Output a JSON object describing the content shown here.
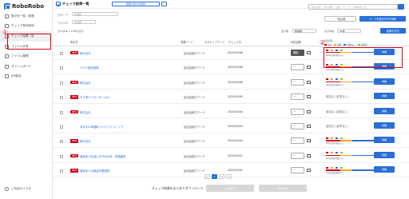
{
  "app": {
    "logo_text": "RoboRobo"
  },
  "sidebar": {
    "items": [
      {
        "label": "取引先一覧・新規",
        "icon": "users-icon"
      },
      {
        "label": "チェック条件設定",
        "icon": "settings-icon"
      },
      {
        "label": "チェック結果一覧",
        "icon": "check-icon"
      },
      {
        "label": "ファイル共有",
        "icon": "file-icon"
      },
      {
        "label": "ファイル管理",
        "icon": "folder-icon"
      },
      {
        "label": "ダッシュボード",
        "icon": "chart-icon"
      },
      {
        "label": "API設定",
        "icon": "gear-icon"
      }
    ],
    "footer_label": "ご利用ガイドを",
    "annotation_number": "①"
  },
  "header": {
    "title": "チェック結果一覧",
    "sub_button": "結果を取引先選択",
    "search_placeholder": "取引先名・法人番号・住所・キーワード検索を入力"
  },
  "filters": {
    "group_label": "グループ",
    "group_value": "未選択",
    "folder_label": "フォルダ",
    "folder_value": "未選択"
  },
  "actions": {
    "list_button": "一括反映",
    "pdf_button": "ページを表示(PDF印刷)",
    "send_button": "結果を送る"
  },
  "summary": {
    "count_text": "全31件中 1-20件を表示",
    "sort_label": "並び順",
    "sort_value": "新着順",
    "per_page_label": "表示件数",
    "per_page_value": "20件"
  },
  "table": {
    "headers": [
      "取引先",
      "重要ワード",
      "ネガティブワード",
      "チェック日",
      "判定結果",
      "ステータス"
    ],
    "rows": [
      {
        "is_new": true,
        "new_label": "NEW",
        "name": "株式会社",
        "type": "反社会勢力ワード",
        "date": "2024/03/06",
        "judgment": "確認",
        "dark": true,
        "status": "",
        "has_mini": true
      },
      {
        "is_new": false,
        "new_label": "",
        "name": "ラクシ歯科医院",
        "type": "反社会勢力ワード",
        "date": "2024/03/06",
        "judgment": "一",
        "dark": false,
        "status": "",
        "has_mini": true
      },
      {
        "is_new": true,
        "new_label": "NEW",
        "name": "株式会社",
        "type": "反社会勢力ワード",
        "date": "2024/03/06",
        "judgment": "一",
        "dark": false,
        "status": "",
        "has_mini": true
      },
      {
        "is_new": true,
        "new_label": "NEW",
        "name": "ホテ恵アイセンター(LS)",
        "type": "反社会勢力ワード",
        "date": "2024/03/05",
        "judgment": "一",
        "dark": false,
        "status": "該当なし(記事なし)",
        "has_mini": false
      },
      {
        "is_new": true,
        "new_label": "NEW",
        "name": "株式会社",
        "type": "反社会勢力ワード",
        "date": "2024/03/04",
        "judgment": "一",
        "dark": false,
        "status": "該当なし(記事なし)",
        "has_mini": false
      },
      {
        "is_new": false,
        "new_label": "",
        "name": "あなかの幸福町リハビリクリニック",
        "type": "反社会勢力ワード",
        "date": "2024/03/04",
        "judgment": "一",
        "dark": false,
        "status": "該当なし(記事なし)",
        "has_mini": false
      },
      {
        "is_new": true,
        "new_label": "NEW",
        "name": "株式会社",
        "type": "反社会勢力ワード",
        "date": "2024/03/04",
        "judgment": "一",
        "dark": false,
        "status": "",
        "has_mini": true
      },
      {
        "is_new": true,
        "new_label": "NEW",
        "name": "医療法人社団いなずみの杜・高橋歯科",
        "type": "反社会勢力ワード",
        "date": "2024/03/01",
        "judgment": "一",
        "dark": false,
        "status": "",
        "has_mini": true
      },
      {
        "is_new": true,
        "new_label": "NEW",
        "name": "医療法人山崎会芦屋医院",
        "type": "反社会勢力ワード",
        "date": "2024/03/01",
        "judgment": "一",
        "dark": false,
        "status": "",
        "has_mini": true
      }
    ],
    "detail_button": "詳細",
    "mini_link": "Web記事を確認する"
  },
  "legend": {
    "title": "判定結果",
    "items": [
      "該当",
      "疑義",
      "問題なし",
      "未確認"
    ],
    "annotation_number": "②"
  },
  "pagination": [
    "<",
    "1",
    "2",
    ">"
  ],
  "footer": {
    "message": "チェック結果をまとめてダウンロード",
    "btn1": "CSV出力",
    "btn2": "PDF出力"
  },
  "colors": {
    "accent": "#2a6fd6",
    "new_badge": "#d0021b",
    "highlight": "#d0021b"
  }
}
